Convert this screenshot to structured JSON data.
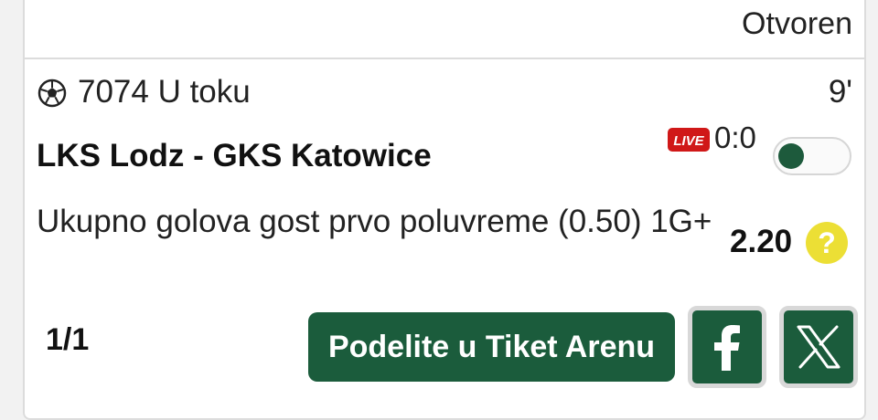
{
  "ticket": {
    "status": "Otvoren"
  },
  "match": {
    "sport_icon": "soccer-ball-icon",
    "code_status": "7074 U toku",
    "minute": "9'",
    "teams": "LKS Lodz - GKS Katowice",
    "live_label": "LIVE",
    "score": "0:0",
    "toggle_on": false
  },
  "bet": {
    "market": "Ukupno golova gost prvo poluvreme (0.50) 1G+",
    "odds": "2.20",
    "help_icon": "question-icon",
    "help_symbol": "?"
  },
  "footer": {
    "page": "1/1",
    "share_label": "Podelite u Tiket Arenu",
    "facebook_icon": "facebook-icon",
    "x_icon": "x-icon"
  },
  "colors": {
    "brand_green": "#1b5c3c",
    "live_red": "#d01818",
    "help_yellow": "#ecdf35"
  }
}
